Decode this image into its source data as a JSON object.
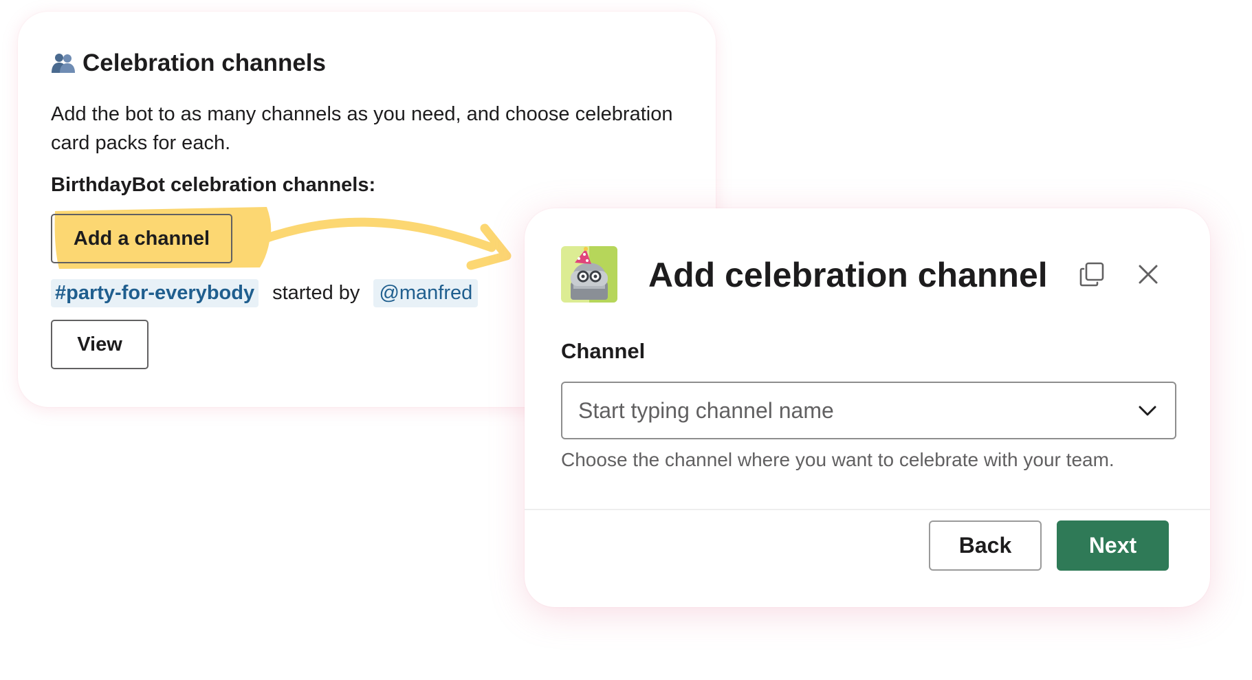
{
  "celebration_card": {
    "title": "Celebration channels",
    "title_icon": "people-icon",
    "description": "Add the bot to as many channels as you need, and choose celebration card packs for each.",
    "subheading": "BirthdayBot celebration channels:",
    "add_channel_label": "Add a channel",
    "channel_name": "#party-for-everybody",
    "started_by_text": "started by",
    "started_by_user": "@manfred",
    "view_label": "View"
  },
  "modal": {
    "avatar_icon": "birthday-bot-avatar",
    "title": "Add celebration channel",
    "copy_icon": "copy-icon",
    "close_icon": "close-icon",
    "field_label": "Channel",
    "select_placeholder": "Start typing channel name",
    "hint": "Choose the channel where you want to celebrate with your team.",
    "back_label": "Back",
    "next_label": "Next"
  },
  "colors": {
    "highlight": "#fcd772",
    "link_chip_bg": "#e8f1f7",
    "link_text": "#1f5e8e",
    "primary_button": "#2f7a57",
    "card_glow": "#e978a0"
  }
}
